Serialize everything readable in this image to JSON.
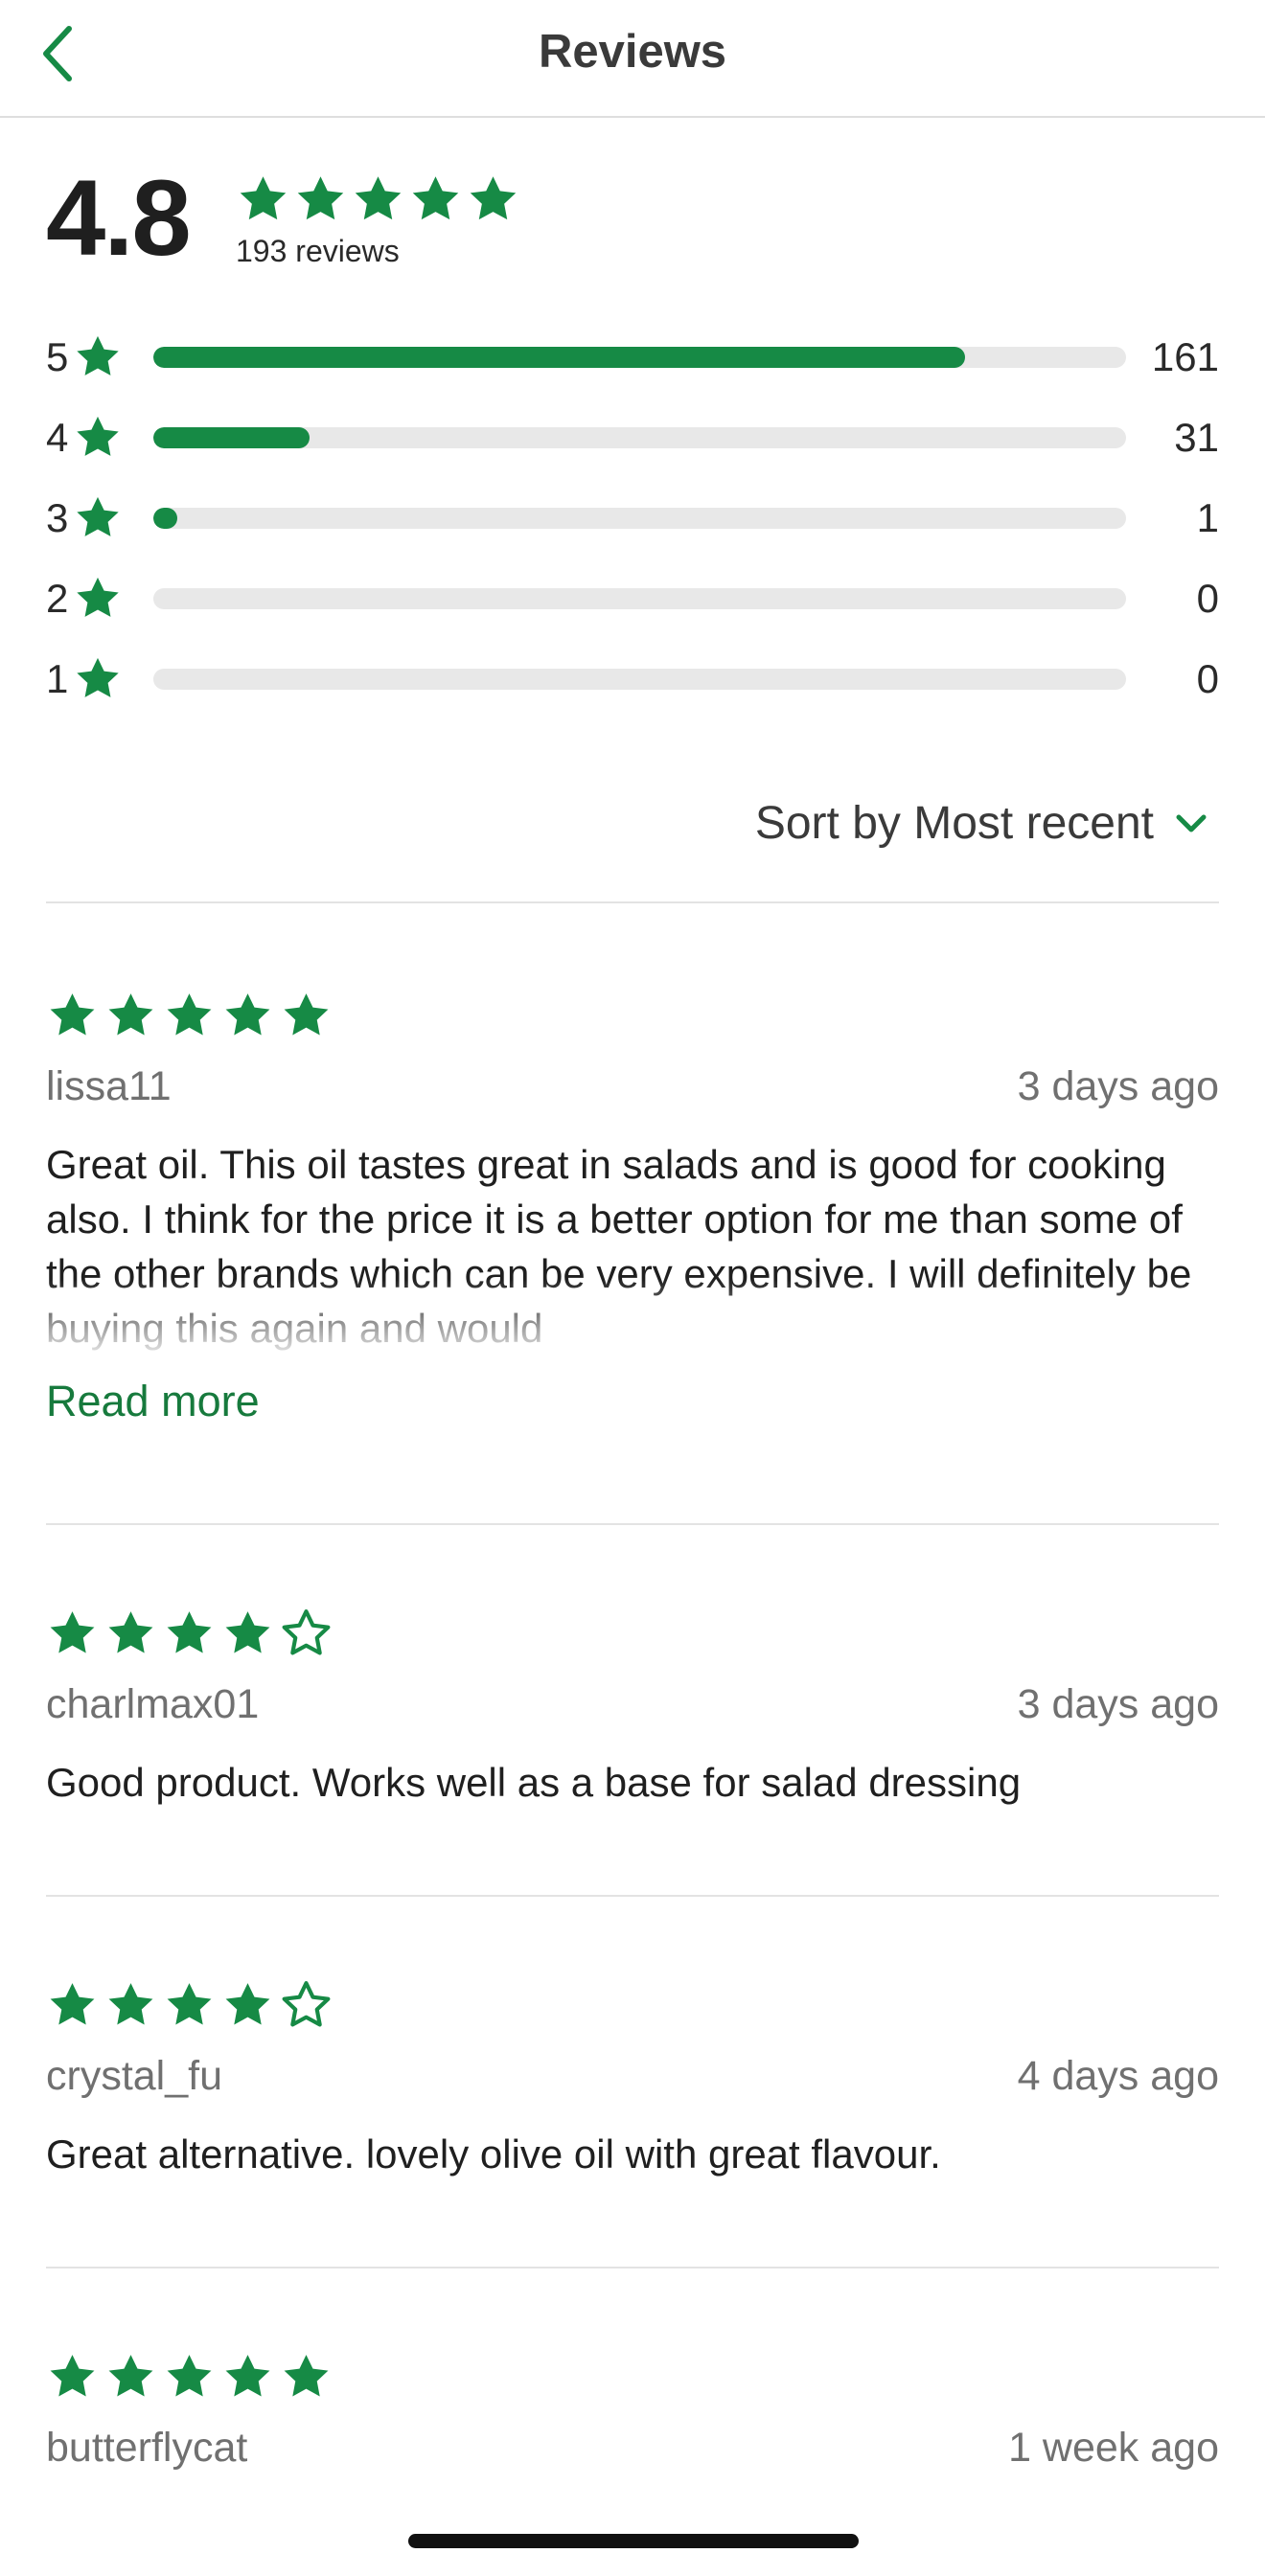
{
  "header": {
    "title": "Reviews"
  },
  "summary": {
    "rating": "4.8",
    "rating_stars": 5,
    "count_label": "193 reviews"
  },
  "distribution": [
    {
      "label": "5",
      "count": "161",
      "fraction": 0.834
    },
    {
      "label": "4",
      "count": "31",
      "fraction": 0.161
    },
    {
      "label": "3",
      "count": "1",
      "fraction": 0.025
    },
    {
      "label": "2",
      "count": "0",
      "fraction": 0
    },
    {
      "label": "1",
      "count": "0",
      "fraction": 0
    }
  ],
  "sort": {
    "label": "Sort by Most recent"
  },
  "reviews": [
    {
      "stars": 5,
      "user": "lissa11",
      "time": "3 days ago",
      "text": "Great oil. This oil tastes great in salads and is good for cooking also. I think for the price it is a better option for me than some of the other brands which can be very expensive. I will definitely be buying this again and would",
      "read_more": "Read more"
    },
    {
      "stars": 4,
      "user": "charlmax01",
      "time": "3 days ago",
      "text": "Good product. Works well as a base for salad dressing"
    },
    {
      "stars": 4,
      "user": "crystal_fu",
      "time": "4 days ago",
      "text": "Great alternative. lovely olive oil with great flavour."
    },
    {
      "stars": 5,
      "user": "butterflycat",
      "time": "1 week ago",
      "text": ""
    }
  ],
  "colors": {
    "accent": "#168a45",
    "track": "#e8e8e8",
    "link": "#177a3d"
  },
  "icons": {
    "back": "chevron-left-icon",
    "star_filled": "star-filled-icon",
    "star_outline": "star-outline-icon",
    "sort": "chevron-down-icon"
  }
}
